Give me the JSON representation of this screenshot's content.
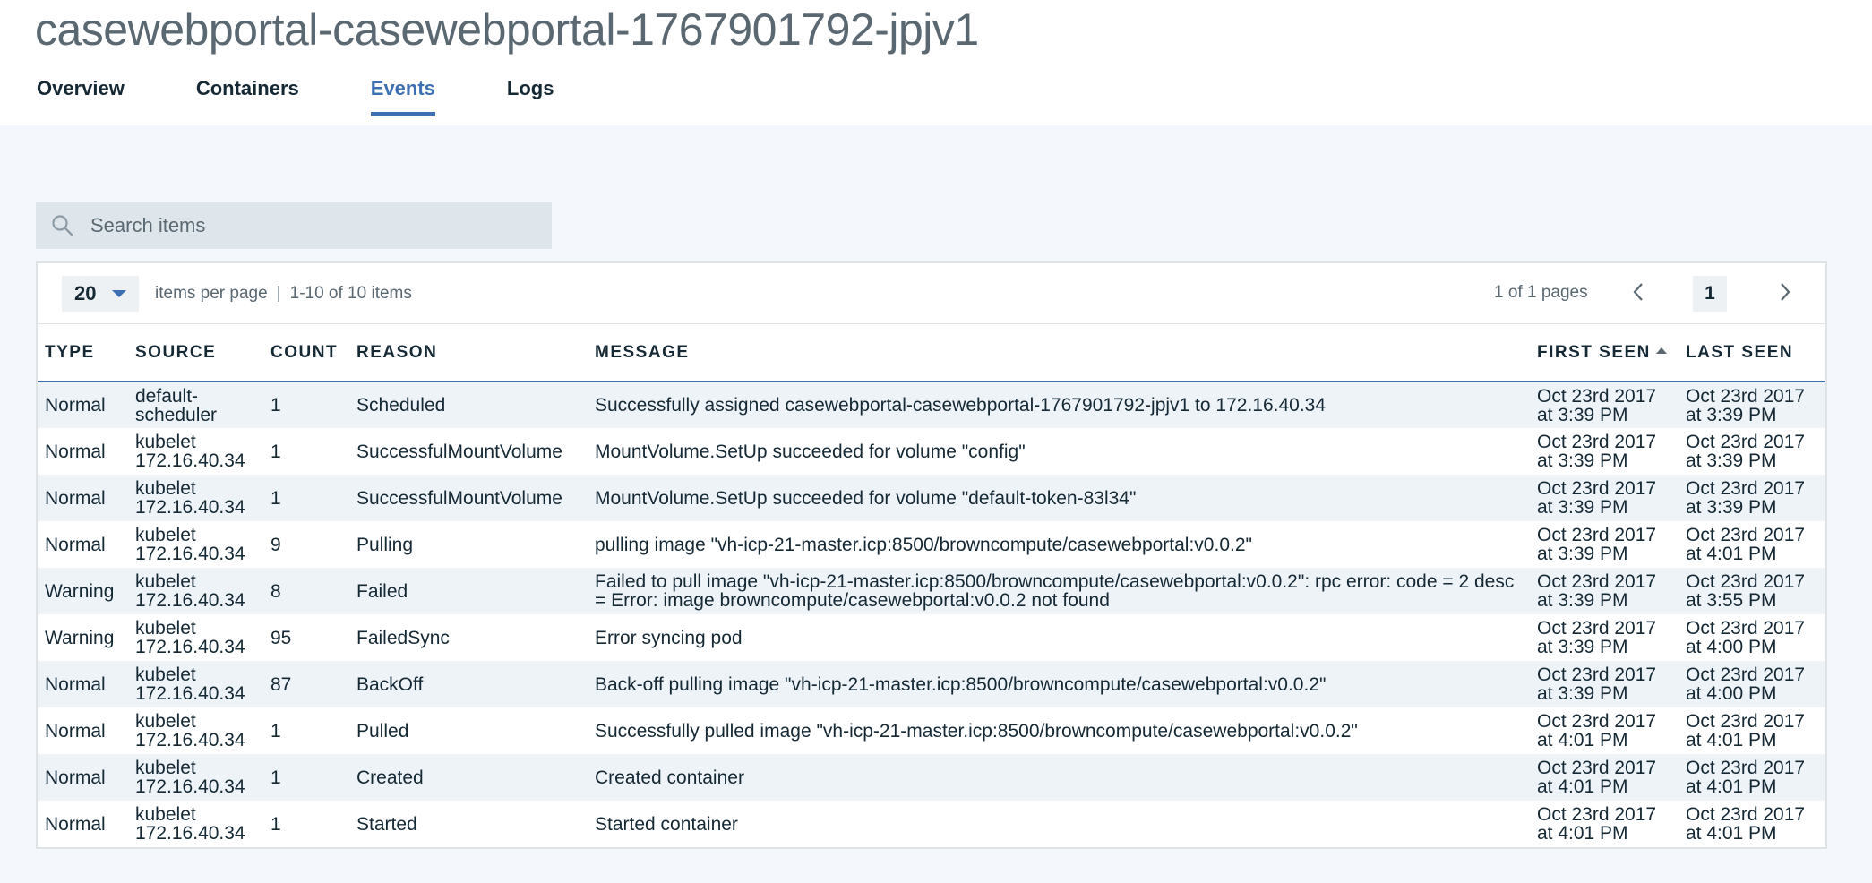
{
  "page_title": "casewebportal-casewebportal-1767901792-jpjv1",
  "tabs": [
    {
      "label": "Overview"
    },
    {
      "label": "Containers"
    },
    {
      "label": "Events"
    },
    {
      "label": "Logs"
    }
  ],
  "active_tab": "Events",
  "search": {
    "placeholder": "Search items",
    "value": ""
  },
  "pagination": {
    "per_page": "20",
    "per_page_label": "items per page",
    "separator": "|",
    "range": "1-10 of 10 items",
    "pages_label": "1 of 1 pages",
    "current_page": "1"
  },
  "columns": [
    "TYPE",
    "SOURCE",
    "COUNT",
    "REASON",
    "MESSAGE",
    "FIRST SEEN",
    "LAST SEEN"
  ],
  "sorted_column": "FIRST SEEN",
  "sort_direction": "ascending",
  "rows": [
    {
      "type": "Normal",
      "source_line1": "default-",
      "source_line2": "scheduler",
      "count": "1",
      "reason": "Scheduled",
      "message": "Successfully assigned casewebportal-casewebportal-1767901792-jpjv1 to 172.16.40.34",
      "first_seen_date": "Oct 23rd 2017",
      "first_seen_time": "at 3:39 PM",
      "last_seen_date": "Oct 23rd 2017",
      "last_seen_time": "at 3:39 PM"
    },
    {
      "type": "Normal",
      "source_line1": "kubelet",
      "source_line2": "172.16.40.34",
      "count": "1",
      "reason": "SuccessfulMountVolume",
      "message": "MountVolume.SetUp succeeded for volume \"config\"",
      "first_seen_date": "Oct 23rd 2017",
      "first_seen_time": "at 3:39 PM",
      "last_seen_date": "Oct 23rd 2017",
      "last_seen_time": "at 3:39 PM"
    },
    {
      "type": "Normal",
      "source_line1": "kubelet",
      "source_line2": "172.16.40.34",
      "count": "1",
      "reason": "SuccessfulMountVolume",
      "message": "MountVolume.SetUp succeeded for volume \"default-token-83l34\"",
      "first_seen_date": "Oct 23rd 2017",
      "first_seen_time": "at 3:39 PM",
      "last_seen_date": "Oct 23rd 2017",
      "last_seen_time": "at 3:39 PM"
    },
    {
      "type": "Normal",
      "source_line1": "kubelet",
      "source_line2": "172.16.40.34",
      "count": "9",
      "reason": "Pulling",
      "message": "pulling image \"vh-icp-21-master.icp:8500/browncompute/casewebportal:v0.0.2\"",
      "first_seen_date": "Oct 23rd 2017",
      "first_seen_time": "at 3:39 PM",
      "last_seen_date": "Oct 23rd 2017",
      "last_seen_time": "at 4:01 PM"
    },
    {
      "type": "Warning",
      "source_line1": "kubelet",
      "source_line2": "172.16.40.34",
      "count": "8",
      "reason": "Failed",
      "message": "Failed to pull image \"vh-icp-21-master.icp:8500/browncompute/casewebportal:v0.0.2\": rpc error: code = 2 desc = Error: image browncompute/casewebportal:v0.0.2 not found",
      "first_seen_date": "Oct 23rd 2017",
      "first_seen_time": "at 3:39 PM",
      "last_seen_date": "Oct 23rd 2017",
      "last_seen_time": "at 3:55 PM"
    },
    {
      "type": "Warning",
      "source_line1": "kubelet",
      "source_line2": "172.16.40.34",
      "count": "95",
      "reason": "FailedSync",
      "message": "Error syncing pod",
      "first_seen_date": "Oct 23rd 2017",
      "first_seen_time": "at 3:39 PM",
      "last_seen_date": "Oct 23rd 2017",
      "last_seen_time": "at 4:00 PM"
    },
    {
      "type": "Normal",
      "source_line1": "kubelet",
      "source_line2": "172.16.40.34",
      "count": "87",
      "reason": "BackOff",
      "message": "Back-off pulling image \"vh-icp-21-master.icp:8500/browncompute/casewebportal:v0.0.2\"",
      "first_seen_date": "Oct 23rd 2017",
      "first_seen_time": "at 3:39 PM",
      "last_seen_date": "Oct 23rd 2017",
      "last_seen_time": "at 4:00 PM"
    },
    {
      "type": "Normal",
      "source_line1": "kubelet",
      "source_line2": "172.16.40.34",
      "count": "1",
      "reason": "Pulled",
      "message": "Successfully pulled image \"vh-icp-21-master.icp:8500/browncompute/casewebportal:v0.0.2\"",
      "first_seen_date": "Oct 23rd 2017",
      "first_seen_time": "at 4:01 PM",
      "last_seen_date": "Oct 23rd 2017",
      "last_seen_time": "at 4:01 PM"
    },
    {
      "type": "Normal",
      "source_line1": "kubelet",
      "source_line2": "172.16.40.34",
      "count": "1",
      "reason": "Created",
      "message": "Created container",
      "first_seen_date": "Oct 23rd 2017",
      "first_seen_time": "at 4:01 PM",
      "last_seen_date": "Oct 23rd 2017",
      "last_seen_time": "at 4:01 PM"
    },
    {
      "type": "Normal",
      "source_line1": "kubelet",
      "source_line2": "172.16.40.34",
      "count": "1",
      "reason": "Started",
      "message": "Started container",
      "first_seen_date": "Oct 23rd 2017",
      "first_seen_time": "at 4:01 PM",
      "last_seen_date": "Oct 23rd 2017",
      "last_seen_time": "at 4:01 PM"
    }
  ],
  "icons": {
    "search": "search-icon",
    "caret": "caret-down-icon",
    "prev": "chevron-left-icon",
    "next": "chevron-right-icon",
    "sort": "sort-ascending-icon"
  },
  "colors": {
    "accent": "#3d70b2",
    "page_bg": "#f4f7fb",
    "row_alt": "#eef3f8",
    "text": "#152935"
  }
}
